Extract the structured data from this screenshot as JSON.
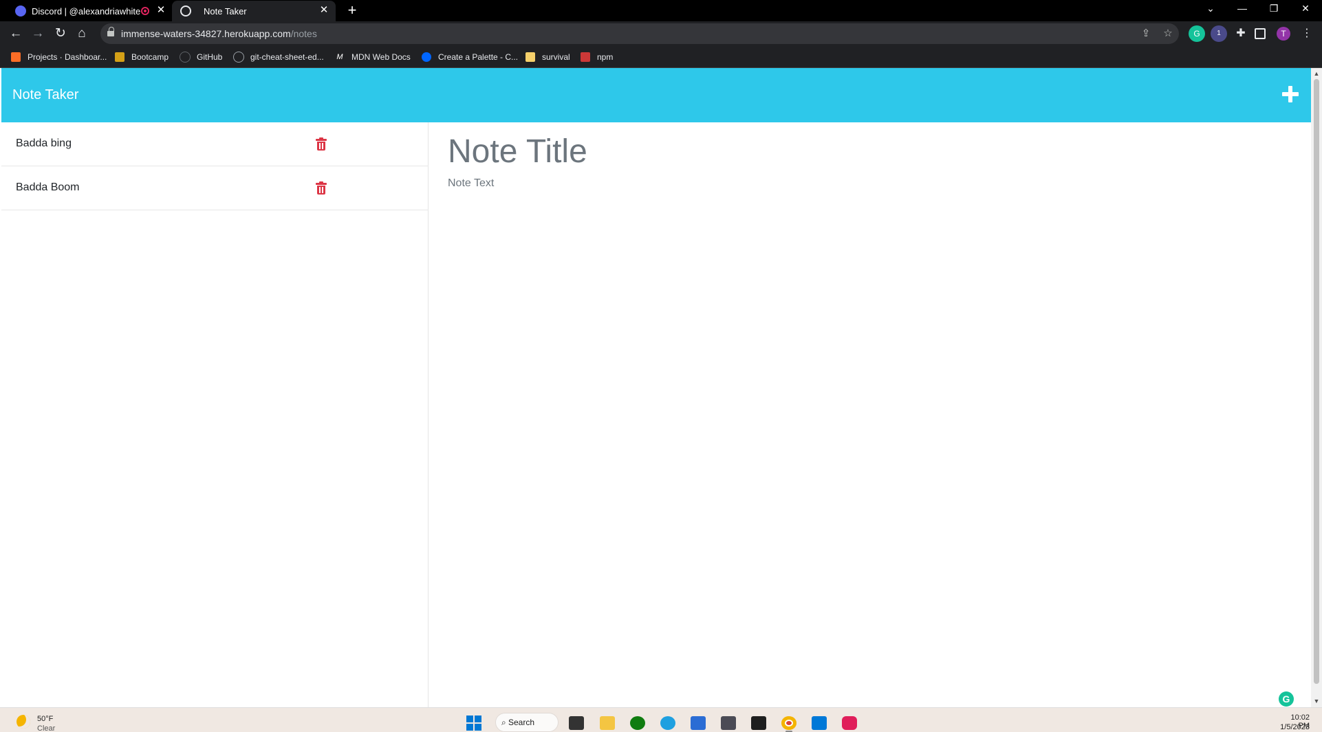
{
  "browser": {
    "tabs": [
      {
        "title": "Discord | @alexandriawhite",
        "icon": "discord-icon",
        "recording": true
      },
      {
        "title": "Note Taker",
        "icon": "globe-icon",
        "active": true
      }
    ],
    "url_host": "immense-waters-34827.herokuapp.com",
    "url_path": "/notes",
    "profile_initial": "T",
    "extension_badge": "1",
    "bookmarks": [
      {
        "label": "Projects · Dashboar...",
        "icon": "gitlab-icon",
        "color": "#fc6d26"
      },
      {
        "label": "Bootcamp",
        "icon": "bootcamp-icon",
        "color": "#d4a017"
      },
      {
        "label": "GitHub",
        "icon": "github-icon",
        "color": "#202124"
      },
      {
        "label": "git-cheat-sheet-ed...",
        "icon": "github-icon",
        "color": "#202124"
      },
      {
        "label": "MDN Web Docs",
        "icon": "mdn-icon",
        "color": "#202124"
      },
      {
        "label": "Create a Palette - C...",
        "icon": "coolors-icon",
        "color": "#0066ff"
      },
      {
        "label": "survival",
        "icon": "folder-icon",
        "color": "#f5d06b"
      },
      {
        "label": "npm",
        "icon": "npm-icon",
        "color": "#cb3837"
      }
    ]
  },
  "app": {
    "brand": "Note Taker",
    "accent_color": "#2ec8ea",
    "notes": [
      {
        "title": "Badda bing"
      },
      {
        "title": "Badda Boom"
      }
    ],
    "editor": {
      "title_placeholder": "Note Title",
      "text_placeholder": "Note Text"
    }
  },
  "taskbar": {
    "weather_temp": "50°F",
    "weather_cond": "Clear",
    "search_label": "Search",
    "time": "10:02 PM",
    "date": "1/5/2023"
  }
}
